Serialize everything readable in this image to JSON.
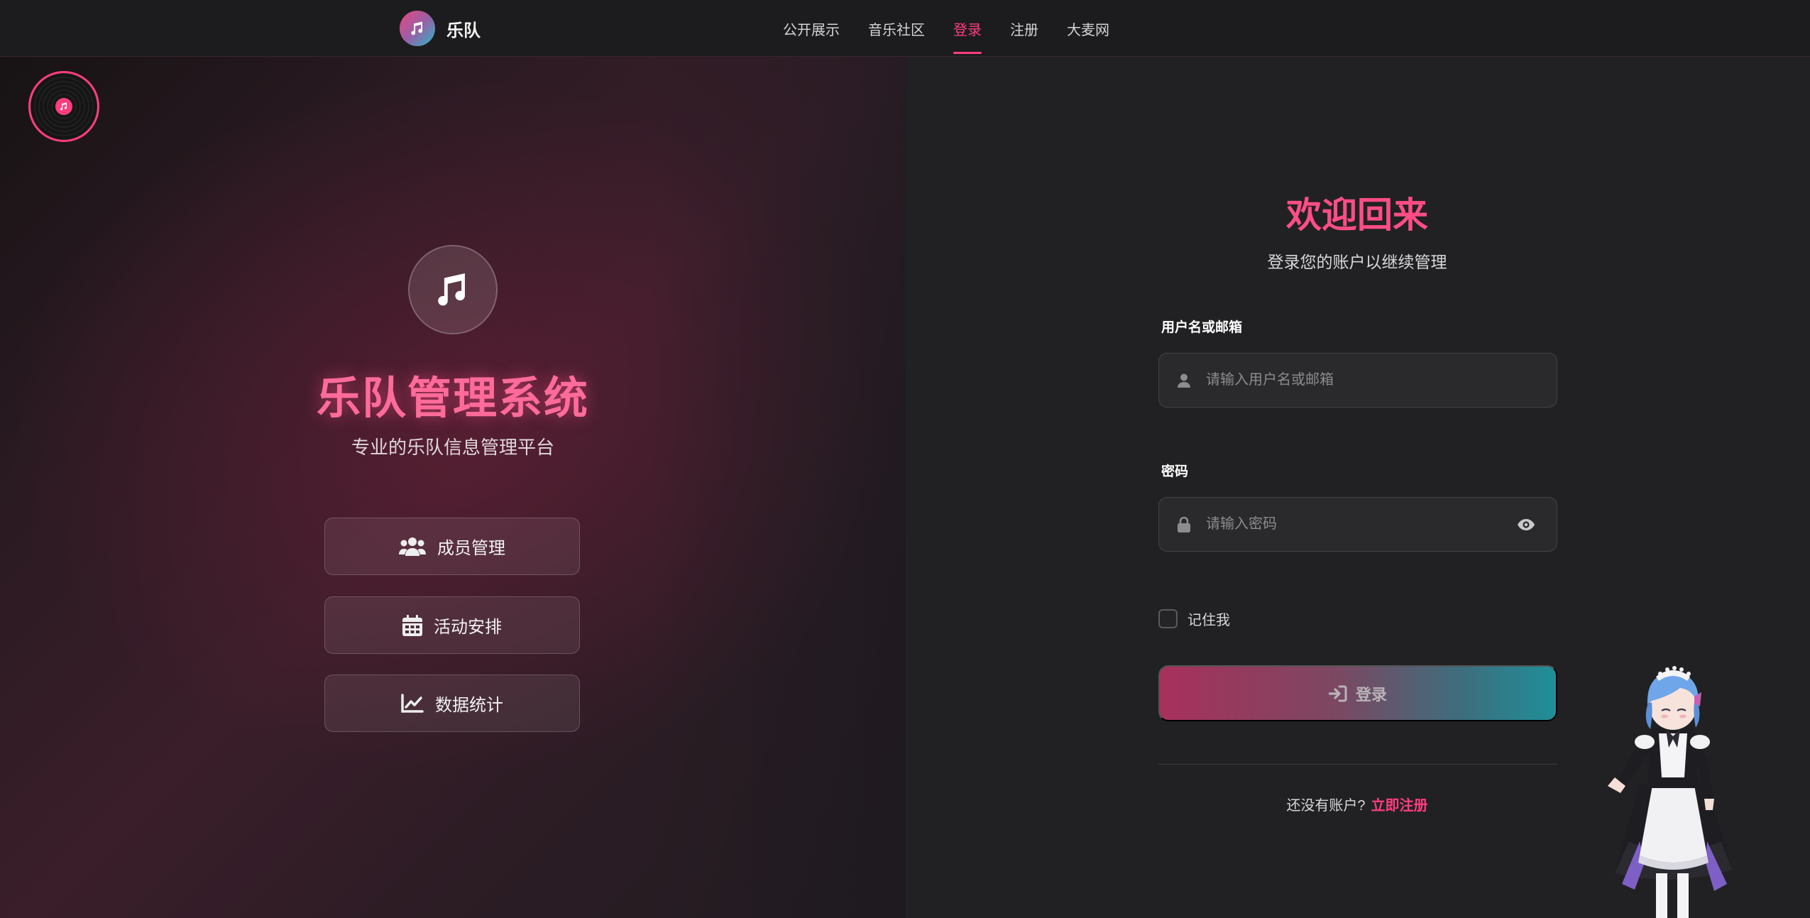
{
  "brand": {
    "name": "乐队",
    "icon": "music-note-icon"
  },
  "nav": {
    "items": [
      {
        "label": "公开展示",
        "active": false
      },
      {
        "label": "音乐社区",
        "active": false
      },
      {
        "label": "登录",
        "active": true
      },
      {
        "label": "注册",
        "active": false
      },
      {
        "label": "大麦网",
        "active": false
      }
    ]
  },
  "hero": {
    "title": "乐队管理系统",
    "subtitle": "专业的乐队信息管理平台",
    "features": [
      {
        "label": "成员管理",
        "icon": "users-icon"
      },
      {
        "label": "活动安排",
        "icon": "calendar-icon"
      },
      {
        "label": "数据统计",
        "icon": "chart-line-icon"
      }
    ]
  },
  "form": {
    "title": "欢迎回来",
    "subtitle": "登录您的账户以继续管理",
    "username_label": "用户名或邮箱",
    "username_placeholder": "请输入用户名或邮箱",
    "password_label": "密码",
    "password_placeholder": "请输入密码",
    "remember_label": "记住我",
    "remember_checked": false,
    "submit_label": "登录",
    "register_prompt": "还没有账户?",
    "register_link": "立即注册"
  },
  "colors": {
    "accent": "#ff3d7f",
    "button_start": "#a8305b",
    "button_end": "#1f8f99",
    "background": "#212123"
  }
}
